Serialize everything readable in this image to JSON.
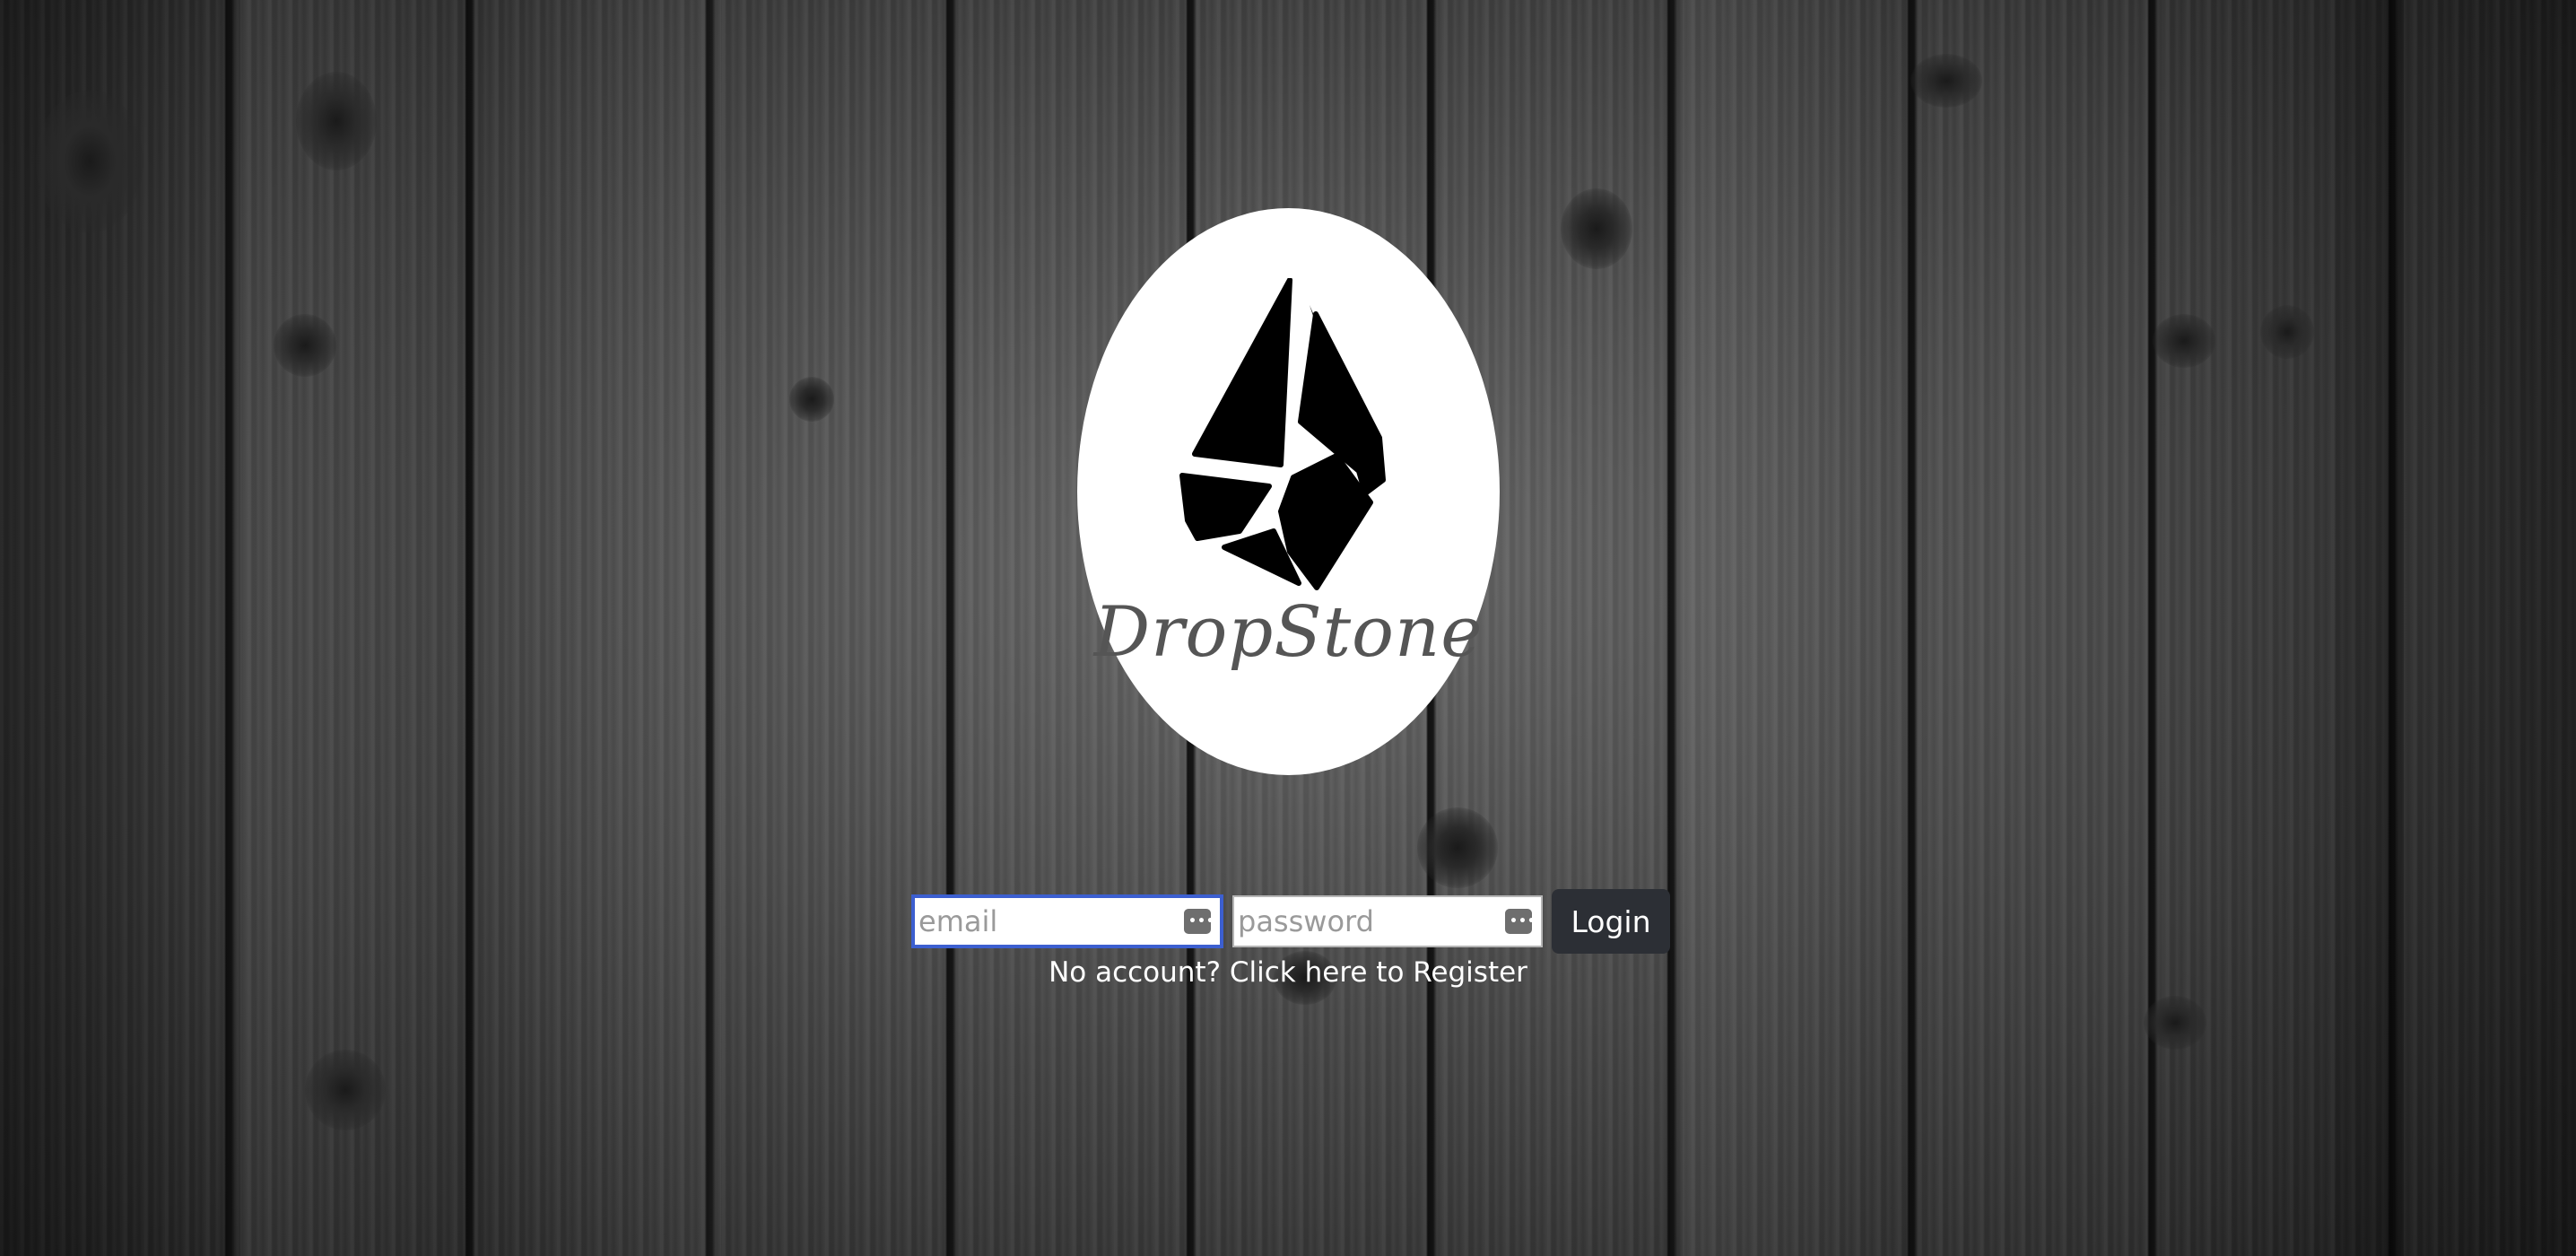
{
  "brand": {
    "name": "DropStone",
    "logo_icon": "drop-stone-icon"
  },
  "login_form": {
    "email_placeholder": "email",
    "email_value": "",
    "password_placeholder": "password",
    "password_value": "",
    "password_manager_icon": "key-dots-icon",
    "login_label": "Login",
    "register_text": "No account? Click here to Register"
  },
  "colors": {
    "focus_border": "#3c5fd0",
    "button_bg": "#2c2f35",
    "logo_bg": "#ffffff",
    "text_light": "#ffffff"
  }
}
